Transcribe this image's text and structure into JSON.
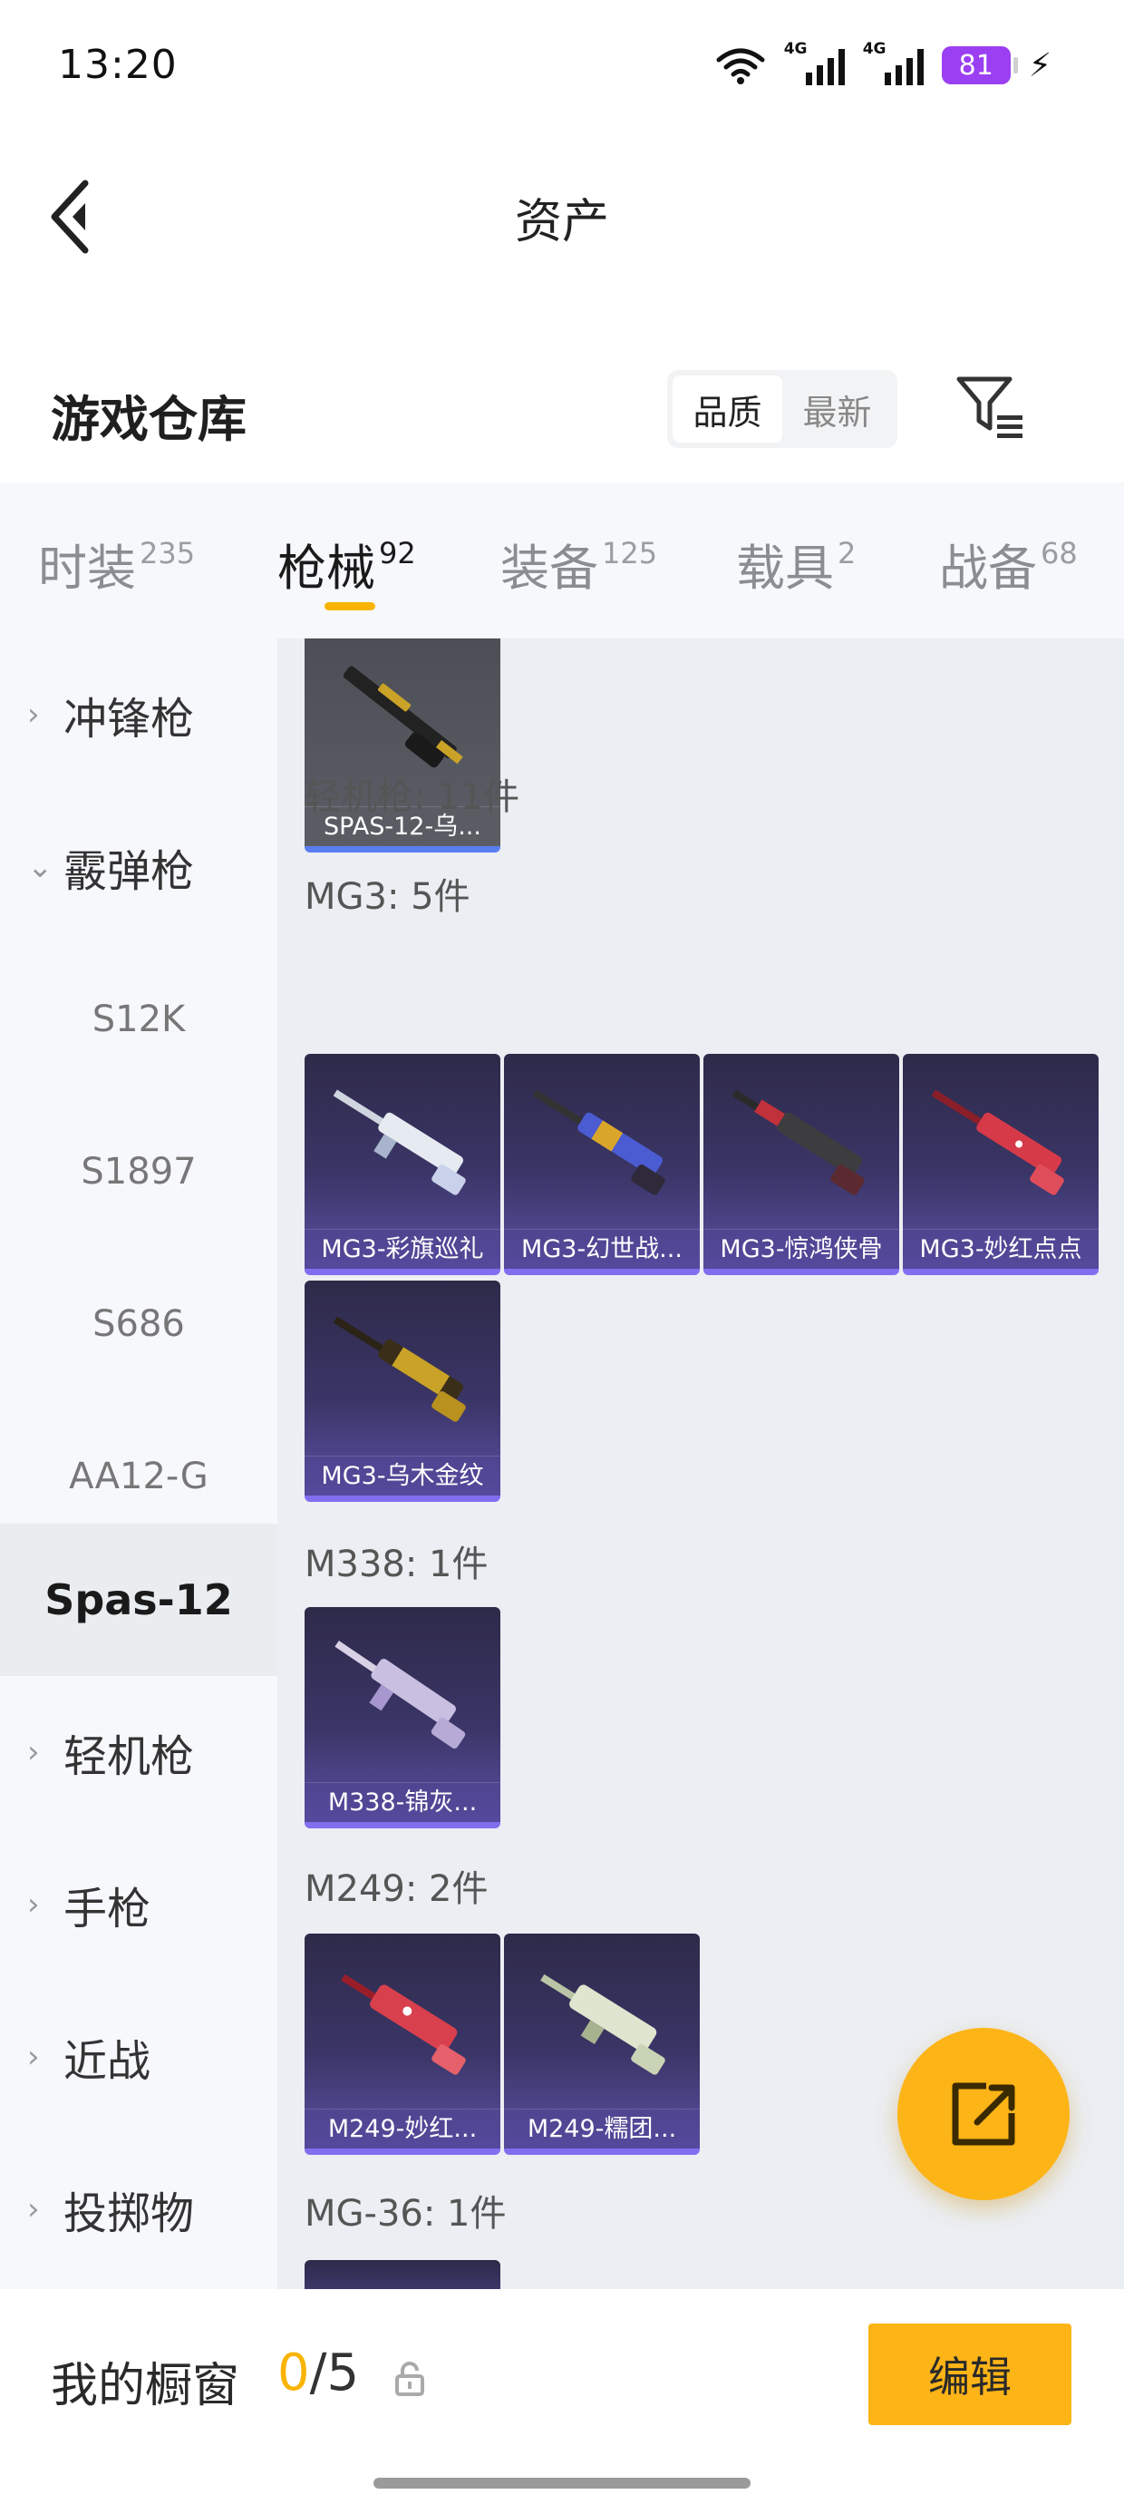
{
  "status_bar": {
    "time": "13:20",
    "network_1": "4G",
    "network_2": "4G",
    "battery": "81",
    "icons": [
      "wifi-icon",
      "signal-icon",
      "signal-icon",
      "battery-icon",
      "charging-icon"
    ]
  },
  "header": {
    "title": "资产",
    "back_icon": "chevron-left-icon"
  },
  "warehouse": {
    "title": "游戏仓库",
    "sort_options": [
      "品质",
      "最新"
    ],
    "sort_selected": "品质",
    "filter_icon": "filter-icon"
  },
  "tabs": [
    {
      "label": "时装",
      "count": "235",
      "active": false
    },
    {
      "label": "枪械",
      "count": "92",
      "active": true
    },
    {
      "label": "装备",
      "count": "125",
      "active": false
    },
    {
      "label": "载具",
      "count": "2",
      "active": false
    },
    {
      "label": "战备",
      "count": "68",
      "active": false
    }
  ],
  "sidenav": [
    {
      "label": "冲锋枪",
      "type": "collapsed"
    },
    {
      "label": "霰弹枪",
      "type": "expanded"
    },
    {
      "label": "S12K",
      "type": "sub"
    },
    {
      "label": "S1897",
      "type": "sub"
    },
    {
      "label": "S686",
      "type": "sub"
    },
    {
      "label": "AA12-G",
      "type": "sub"
    },
    {
      "label": "Spas-12",
      "type": "selected"
    },
    {
      "label": "轻机枪",
      "type": "collapsed"
    },
    {
      "label": "手枪",
      "type": "collapsed"
    },
    {
      "label": "近战",
      "type": "collapsed"
    },
    {
      "label": "投掷物",
      "type": "collapsed"
    }
  ],
  "main": {
    "top_item": "SPAS-12-乌...",
    "lmg_total": "轻机枪: 11件",
    "groups": [
      {
        "label": "MG3: 5件",
        "items": [
          "MG3-彩旗巡礼",
          "MG3-幻世战...",
          "MG3-惊鸿侠骨",
          "MG3-妙红点点",
          "MG3-乌木金纹"
        ]
      },
      {
        "label": "M338: 1件",
        "items": [
          "M338-锦灰..."
        ]
      },
      {
        "label": "M249: 2件",
        "items": [
          "M249-妙红...",
          "M249-糯团..."
        ]
      },
      {
        "label": "MG-36: 1件",
        "items": []
      }
    ]
  },
  "fab_icon": "share-icon",
  "showcase": {
    "label": "我的橱窗",
    "current": "0",
    "total": "/5",
    "lock_icon": "lock-icon",
    "edit_label": "编辑"
  },
  "colors": {
    "accent": "#fdb417",
    "tab_active_underline": "#f8b400",
    "card_purple": "#3a3566"
  }
}
